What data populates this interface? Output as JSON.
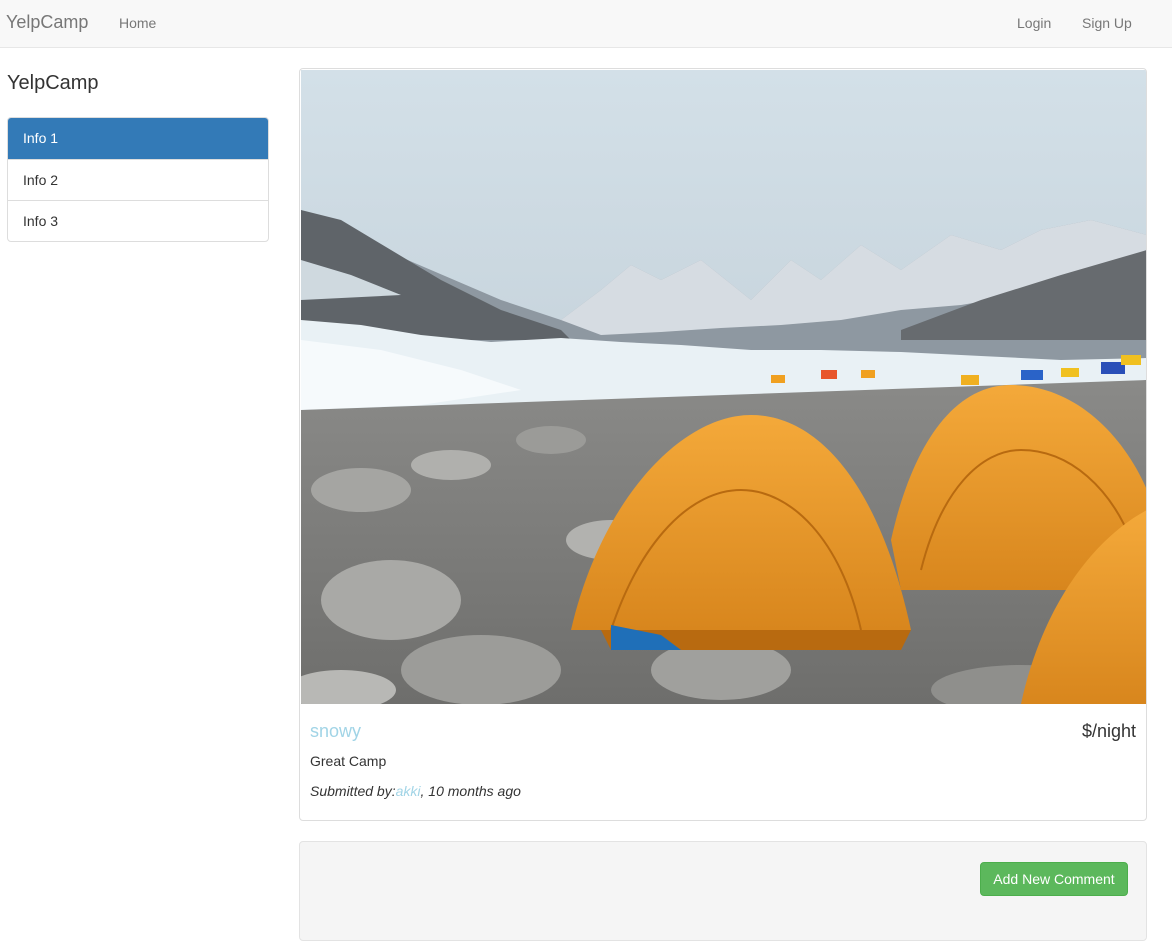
{
  "navbar": {
    "brand": "YelpCamp",
    "home": "Home",
    "login": "Login",
    "signup": "Sign Up"
  },
  "sidebar": {
    "title": "YelpCamp",
    "items": [
      {
        "label": "Info 1",
        "active": true
      },
      {
        "label": "Info 2",
        "active": false
      },
      {
        "label": "Info 3",
        "active": false
      }
    ]
  },
  "campground": {
    "name": "snowy",
    "price": "$/night",
    "description": "Great Camp",
    "submitted_prefix": "Submitted by:",
    "author": "akki",
    "time_ago": ", 10 months ago"
  },
  "comments": {
    "add_button": "Add New Comment"
  },
  "colors": {
    "accent": "#337ab7",
    "success": "#5cb85c",
    "link": "#a1d4e6"
  }
}
